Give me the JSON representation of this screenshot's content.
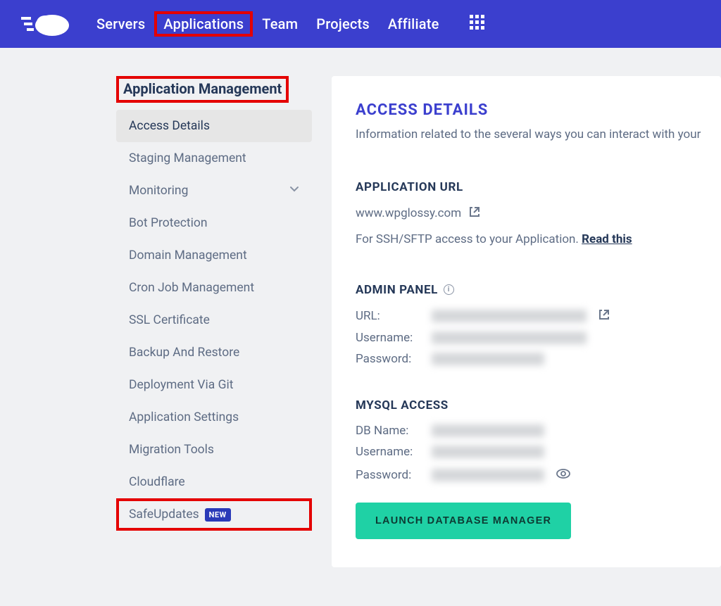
{
  "nav": {
    "servers": "Servers",
    "applications": "Applications",
    "team": "Team",
    "projects": "Projects",
    "affiliate": "Affiliate"
  },
  "sidebar": {
    "title": "Application Management",
    "items": {
      "access_details": "Access Details",
      "staging": "Staging Management",
      "monitoring": "Monitoring",
      "bot": "Bot Protection",
      "domain": "Domain Management",
      "cron": "Cron Job Management",
      "ssl": "SSL Certificate",
      "backup": "Backup And Restore",
      "git": "Deployment Via Git",
      "settings": "Application Settings",
      "migration": "Migration Tools",
      "cloudflare": "Cloudflare",
      "safeupdates": "SafeUpdates",
      "new_badge": "NEW"
    }
  },
  "content": {
    "title": "ACCESS DETAILS",
    "desc": "Information related to the several ways you can interact with your",
    "app_url_head": "APPLICATION URL",
    "app_url_value": "www.wpglossy.com",
    "ssh_prefix": "For SSH/SFTP access to your Application. ",
    "read_this": "Read this",
    "admin_panel_head": "ADMIN PANEL",
    "url_label": "URL:",
    "username_label": "Username:",
    "password_label": "Password:",
    "mysql_head": "MYSQL ACCESS",
    "dbname_label": "DB Name:",
    "launch_btn": "LAUNCH DATABASE MANAGER"
  }
}
